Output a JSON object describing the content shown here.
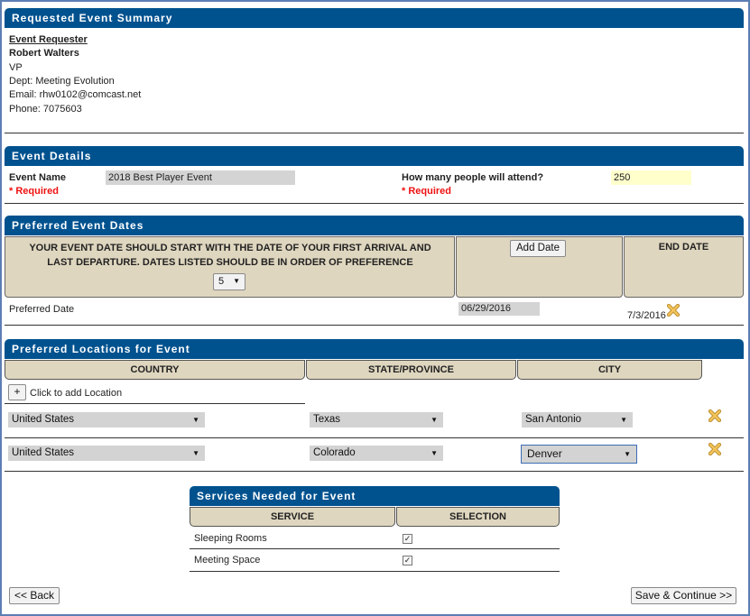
{
  "summary": {
    "title": "Requested Event Summary",
    "requester_heading": "Event Requester",
    "name": "Robert Walters",
    "position": "VP",
    "dept": "Dept: Meeting Evolution",
    "email": "Email: rhw0102@comcast.net",
    "phone": "Phone: 7075603"
  },
  "details": {
    "title": "Event Details",
    "event_name_label": "Event Name",
    "event_name_value": "2018 Best Player Event",
    "required_text": "* Required",
    "attend_label": "How many people will attend?",
    "attend_value": "250",
    "attend_required_text": "* Required"
  },
  "dates": {
    "title": "Preferred Event Dates",
    "instruction": "YOUR EVENT DATE SHOULD START WITH THE DATE OF YOUR FIRST ARRIVAL AND LAST DEPARTURE. DATES LISTED SHOULD BE IN ORDER OF PREFERENCE",
    "count_value": "5",
    "add_date_label": "Add Date",
    "end_date_header": "END DATE",
    "preferred_label": "Preferred Date",
    "start_value": "06/29/2016",
    "end_value": "7/3/2016"
  },
  "locations": {
    "title": "Preferred Locations for Event",
    "headers": [
      "COUNTRY",
      "STATE/PROVINCE",
      "CITY"
    ],
    "add_button_symbol": "+",
    "add_label": "Click to add Location",
    "rows": [
      {
        "country": "United States",
        "state": "Texas",
        "city": "San Antonio"
      },
      {
        "country": "United States",
        "state": "Colorado",
        "city": "Denver"
      }
    ]
  },
  "services": {
    "title": "Services Needed for Event",
    "headers": [
      "SERVICE",
      "SELECTION"
    ],
    "rows": [
      {
        "name": "Sleeping Rooms",
        "checked": true
      },
      {
        "name": "Meeting Space",
        "checked": true
      }
    ]
  },
  "footer": {
    "back_label": "<< Back",
    "continue_label": "Save & Continue >>"
  },
  "colors": {
    "header_blue": "#00528f",
    "tan": "#dfd6bf",
    "required_red": "#ee1111",
    "highlight_yellow": "#ffffcc"
  }
}
